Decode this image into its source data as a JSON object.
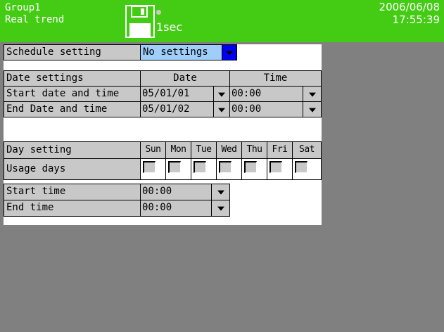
{
  "header": {
    "group": "Group1",
    "mode": "Real trend",
    "rate": "1sec",
    "date": "2006/06/08",
    "time": "17:55:39"
  },
  "schedule": {
    "label": "Schedule setting",
    "value": "No settings"
  },
  "date_settings": {
    "label": "Date settings",
    "col_date": "Date",
    "col_time": "Time",
    "rows": [
      {
        "label": "Start date and time",
        "date": "05/01/01",
        "time": "00:00"
      },
      {
        "label": "End Date and time",
        "date": "05/01/02",
        "time": "00:00"
      }
    ]
  },
  "day_settings": {
    "label": "Day setting",
    "days": [
      "Sun",
      "Mon",
      "Tue",
      "Wed",
      "Thu",
      "Fri",
      "Sat"
    ],
    "usage_label": "Usage days",
    "usage": [
      false,
      false,
      false,
      false,
      false,
      false,
      false
    ],
    "start_label": "Start time",
    "start_value": "00:00",
    "end_label": "End time",
    "end_value": "00:00"
  },
  "colors": {
    "header_bg": "#44cc14",
    "screen_bg": "#808080",
    "cell_bg": "#c8c8c8",
    "highlight": "#9fcff9",
    "dropdown_active": "#0000f0"
  },
  "icons": {
    "disk": "floppy-disk-icon",
    "status": "status-dot-icon",
    "dropdown": "chevron-down-icon"
  }
}
